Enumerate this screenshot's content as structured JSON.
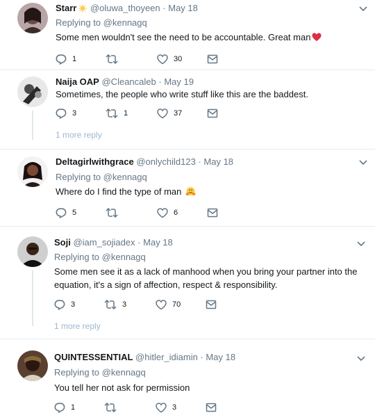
{
  "tweets": [
    {
      "name": "Starr",
      "name_emoji": "sun",
      "handle": "@oluwa_thoyeen",
      "separator": "·",
      "time": "May 18",
      "replying_prefix": "Replying to",
      "replying_to": "@kennagq",
      "text": "Some men wouldn't see the need to be accountable. Great man",
      "text_emoji": "red-heart",
      "replies": "1",
      "retweets": "",
      "likes": "30"
    },
    {
      "name": "Naija OAP",
      "handle": "@Cleancaleb",
      "separator": "·",
      "time": "May 19",
      "text": "Sometimes, the people who write stuff like this are the baddest.",
      "replies": "3",
      "retweets": "1",
      "likes": "37",
      "more_replies": "1 more reply"
    },
    {
      "name": "Deltagirlwithgrace",
      "handle": "@onlychild123",
      "separator": "·",
      "time": "May 18",
      "replying_prefix": "Replying to",
      "replying_to": "@kennagq",
      "text": "Where do I find the type of man",
      "text_emoji": "hugging-face",
      "replies": "5",
      "retweets": "",
      "likes": "6"
    },
    {
      "name": "Soji",
      "handle": "@iam_sojiadex",
      "separator": "·",
      "time": "May 18",
      "replying_prefix": "Replying to",
      "replying_to": "@kennagq",
      "text_line1": "Some men see it as a lack of manhood when you bring your partner into the",
      "text_line2": "equation, it's a sign of affection, respect & responsibility.",
      "replies": "3",
      "retweets": "3",
      "likes": "70",
      "more_replies": "1 more reply"
    },
    {
      "name": "QUINTESSENTIAL",
      "handle": "@hitler_idiamin",
      "separator": "·",
      "time": "May 18",
      "replying_prefix": "Replying to",
      "replying_to": "@kennagq",
      "text": "You tell her not ask for permission",
      "replies": "1",
      "retweets": "",
      "likes": "3"
    }
  ],
  "icons": {
    "reply": "reply-icon",
    "retweet": "retweet-icon",
    "like": "heart-icon",
    "dm": "envelope-icon",
    "menu": "chevron-down-icon"
  },
  "colors": {
    "secondary_text": "#657786",
    "link": "#1da1f2",
    "divider": "#e6ecf0",
    "heart_emoji": "#e0245e"
  }
}
